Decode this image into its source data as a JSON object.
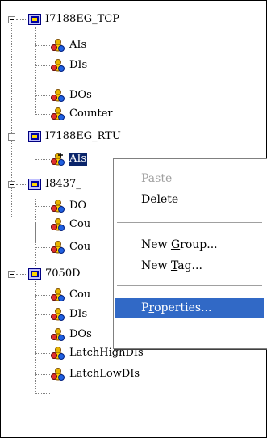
{
  "tree": {
    "devices": [
      {
        "label": "I7188EG_TCP",
        "children": [
          "AIs",
          "DIs",
          "DOs",
          "Counter"
        ]
      },
      {
        "label": "I7188EG_RTU",
        "children": [
          "AIs"
        ]
      },
      {
        "label": "I8437_",
        "children": [
          "DO",
          "Cou",
          "Cou"
        ]
      },
      {
        "label": "7050D",
        "children": [
          "Cou",
          "DIs",
          "DOs",
          "LatchHighDIs",
          "LatchLowDIs"
        ]
      }
    ]
  },
  "context_menu": {
    "items": [
      {
        "label": "Paste",
        "underline": "P",
        "disabled": true
      },
      {
        "label": "Delete",
        "underline": "D",
        "disabled": false
      },
      {
        "label": "New Group...",
        "underline": "G",
        "disabled": false
      },
      {
        "label": "New Tag...",
        "underline": "T",
        "disabled": false
      },
      {
        "label": "Properties...",
        "underline": "r",
        "disabled": false,
        "highlighted": true
      }
    ]
  },
  "colors": {
    "selection": "#0a246a",
    "menu_highlight": "#3169c6"
  }
}
